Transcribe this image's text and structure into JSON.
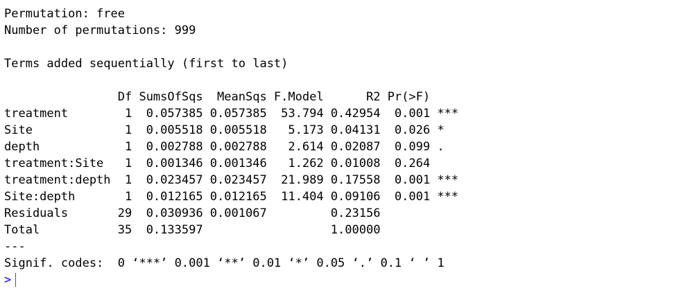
{
  "console": {
    "header": [
      "Permutation: free",
      "Number of permutations: 999"
    ],
    "terms_note": "Terms added sequentially (first to last)",
    "table": {
      "header_row": "                Df SumsOfSqs  MeanSqs F.Model      R2 Pr(>F)    ",
      "rows": [
        "treatment        1  0.057385 0.057385  53.794 0.42954  0.001 ***",
        "Site             1  0.005518 0.005518   5.173 0.04131  0.026 *  ",
        "depth            1  0.002788 0.002788   2.614 0.02087  0.099 .  ",
        "treatment:Site   1  0.001346 0.001346   1.262 0.01008  0.264    ",
        "treatment:depth  1  0.023457 0.023457  21.989 0.17558  0.001 ***",
        "Site:depth       1  0.012165 0.012165  11.404 0.09106  0.001 ***",
        "Residuals       29  0.030936 0.001067         0.23156           ",
        "Total           35  0.133597                  1.00000           "
      ]
    },
    "separator": "---",
    "signif_codes": "Signif. codes:  0 ‘***’ 0.001 ‘**’ 0.01 ‘*’ 0.05 ‘.’ 0.1 ‘ ’ 1",
    "prompt": ">"
  },
  "colors": {
    "prompt": "#0000ff",
    "text": "#000000",
    "background": "#ffffff"
  }
}
